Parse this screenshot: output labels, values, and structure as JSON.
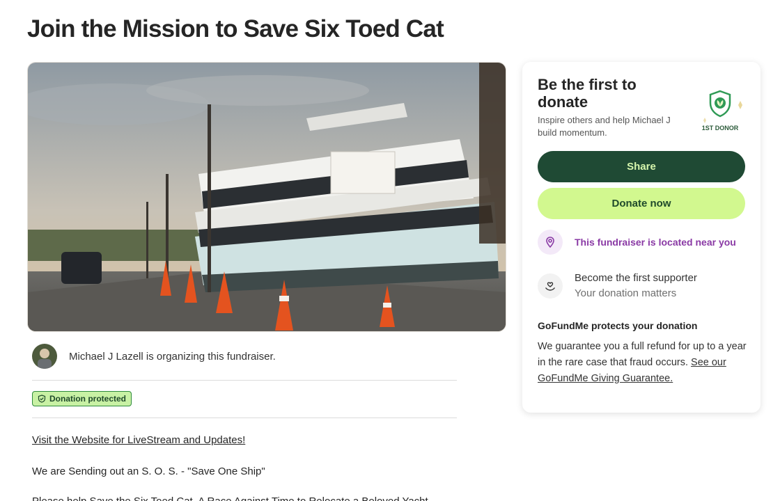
{
  "page": {
    "title": "Join the Mission to Save Six Toed Cat"
  },
  "organizer": {
    "text": "Michael J Lazell is organizing this fundraiser."
  },
  "badge": {
    "label": "Donation protected"
  },
  "story": {
    "link_text": "Visit the Website for LiveStream and Updates!",
    "paragraph1": "We are Sending out an S. O. S. - \"Save One Ship\"",
    "paragraph2": "Please help Save the Six Toed Cat, A Race Against Time to Relocate a Beloved Yacht"
  },
  "card": {
    "title": "Be the first to donate",
    "subtitle": "Inspire others and help Michael J build momentum.",
    "badge_label": "1ST DONOR",
    "share_label": "Share",
    "donate_label": "Donate now",
    "location_text": "This fundraiser is located near you",
    "supporter_title": "Become the first supporter",
    "supporter_sub": "Your donation matters",
    "protect_title": "GoFundMe protects your donation",
    "protect_body": "We guarantee you a full refund for up to a year in the rare case that fraud occurs.",
    "protect_link": "See our GoFundMe Giving Guarantee."
  },
  "colors": {
    "share_bg": "#1f4a34",
    "donate_bg": "#d2f88f",
    "location_purple": "#8a3aa5",
    "badge_green": "#c8f1a4"
  },
  "icons": {
    "badge": "shield-check-icon",
    "emblem": "shield-leaf-icon",
    "location": "map-pin-icon",
    "supporter": "hand-heart-icon"
  }
}
